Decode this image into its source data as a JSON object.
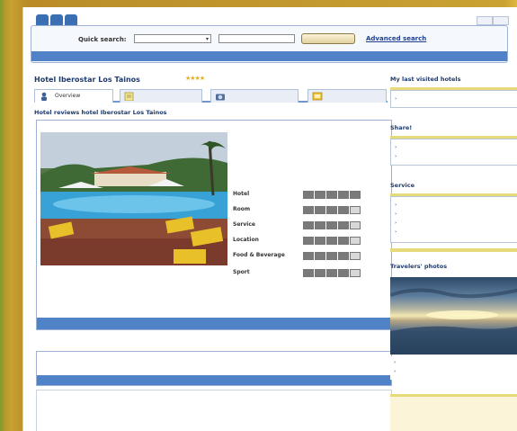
{
  "nav": {
    "tabs": [
      "",
      "",
      ""
    ],
    "links": [
      "",
      ""
    ]
  },
  "search": {
    "label": "Quick search:",
    "selected": "",
    "button": "",
    "advanced": "Advanced search",
    "breadcrumb": ""
  },
  "hotel": {
    "title": "Hotel Iberostar Los Tainos",
    "stars": "★★★★"
  },
  "tabs": [
    {
      "label": "Overview"
    },
    {
      "label": ""
    },
    {
      "label": ""
    },
    {
      "label": ""
    }
  ],
  "reviews": {
    "section_title": "Hotel reviews hotel Iberostar Los Tainos",
    "stats": [
      {
        "label": "",
        "value": ""
      },
      {
        "label": "",
        "value": ""
      },
      {
        "label": "",
        "value": ""
      },
      {
        "label": "",
        "value": ""
      },
      {
        "label": "",
        "value": ""
      }
    ],
    "ratings_title": "",
    "ratings": [
      {
        "label": "Hotel",
        "value": "",
        "filled": 5
      },
      {
        "label": "Room",
        "value": "",
        "filled": 4
      },
      {
        "label": "Service",
        "value": "",
        "filled": 4
      },
      {
        "label": "Location",
        "value": "",
        "filled": 4
      },
      {
        "label": "Food & Beverage",
        "value": "",
        "filled": 4
      },
      {
        "label": "Sport",
        "value": "",
        "filled": 4
      }
    ],
    "note": "",
    "all_reviews": ""
  },
  "description": {
    "section_title": "",
    "text": "",
    "bar": ""
  },
  "ad": {
    "title": "",
    "line2": "",
    "link_left": "",
    "link_right": ""
  },
  "sidebar": {
    "last_visited_title": "My last visited hotels",
    "last_visited": [
      ""
    ],
    "share_title": "Share!",
    "share": [
      "",
      ""
    ],
    "service_title": "Service",
    "service": [
      "",
      "",
      "",
      ""
    ],
    "photos_title": "Travelers' photos",
    "photos_links": [
      "",
      ""
    ],
    "ads_title": "",
    "ads": [
      "",
      "",
      ""
    ]
  }
}
